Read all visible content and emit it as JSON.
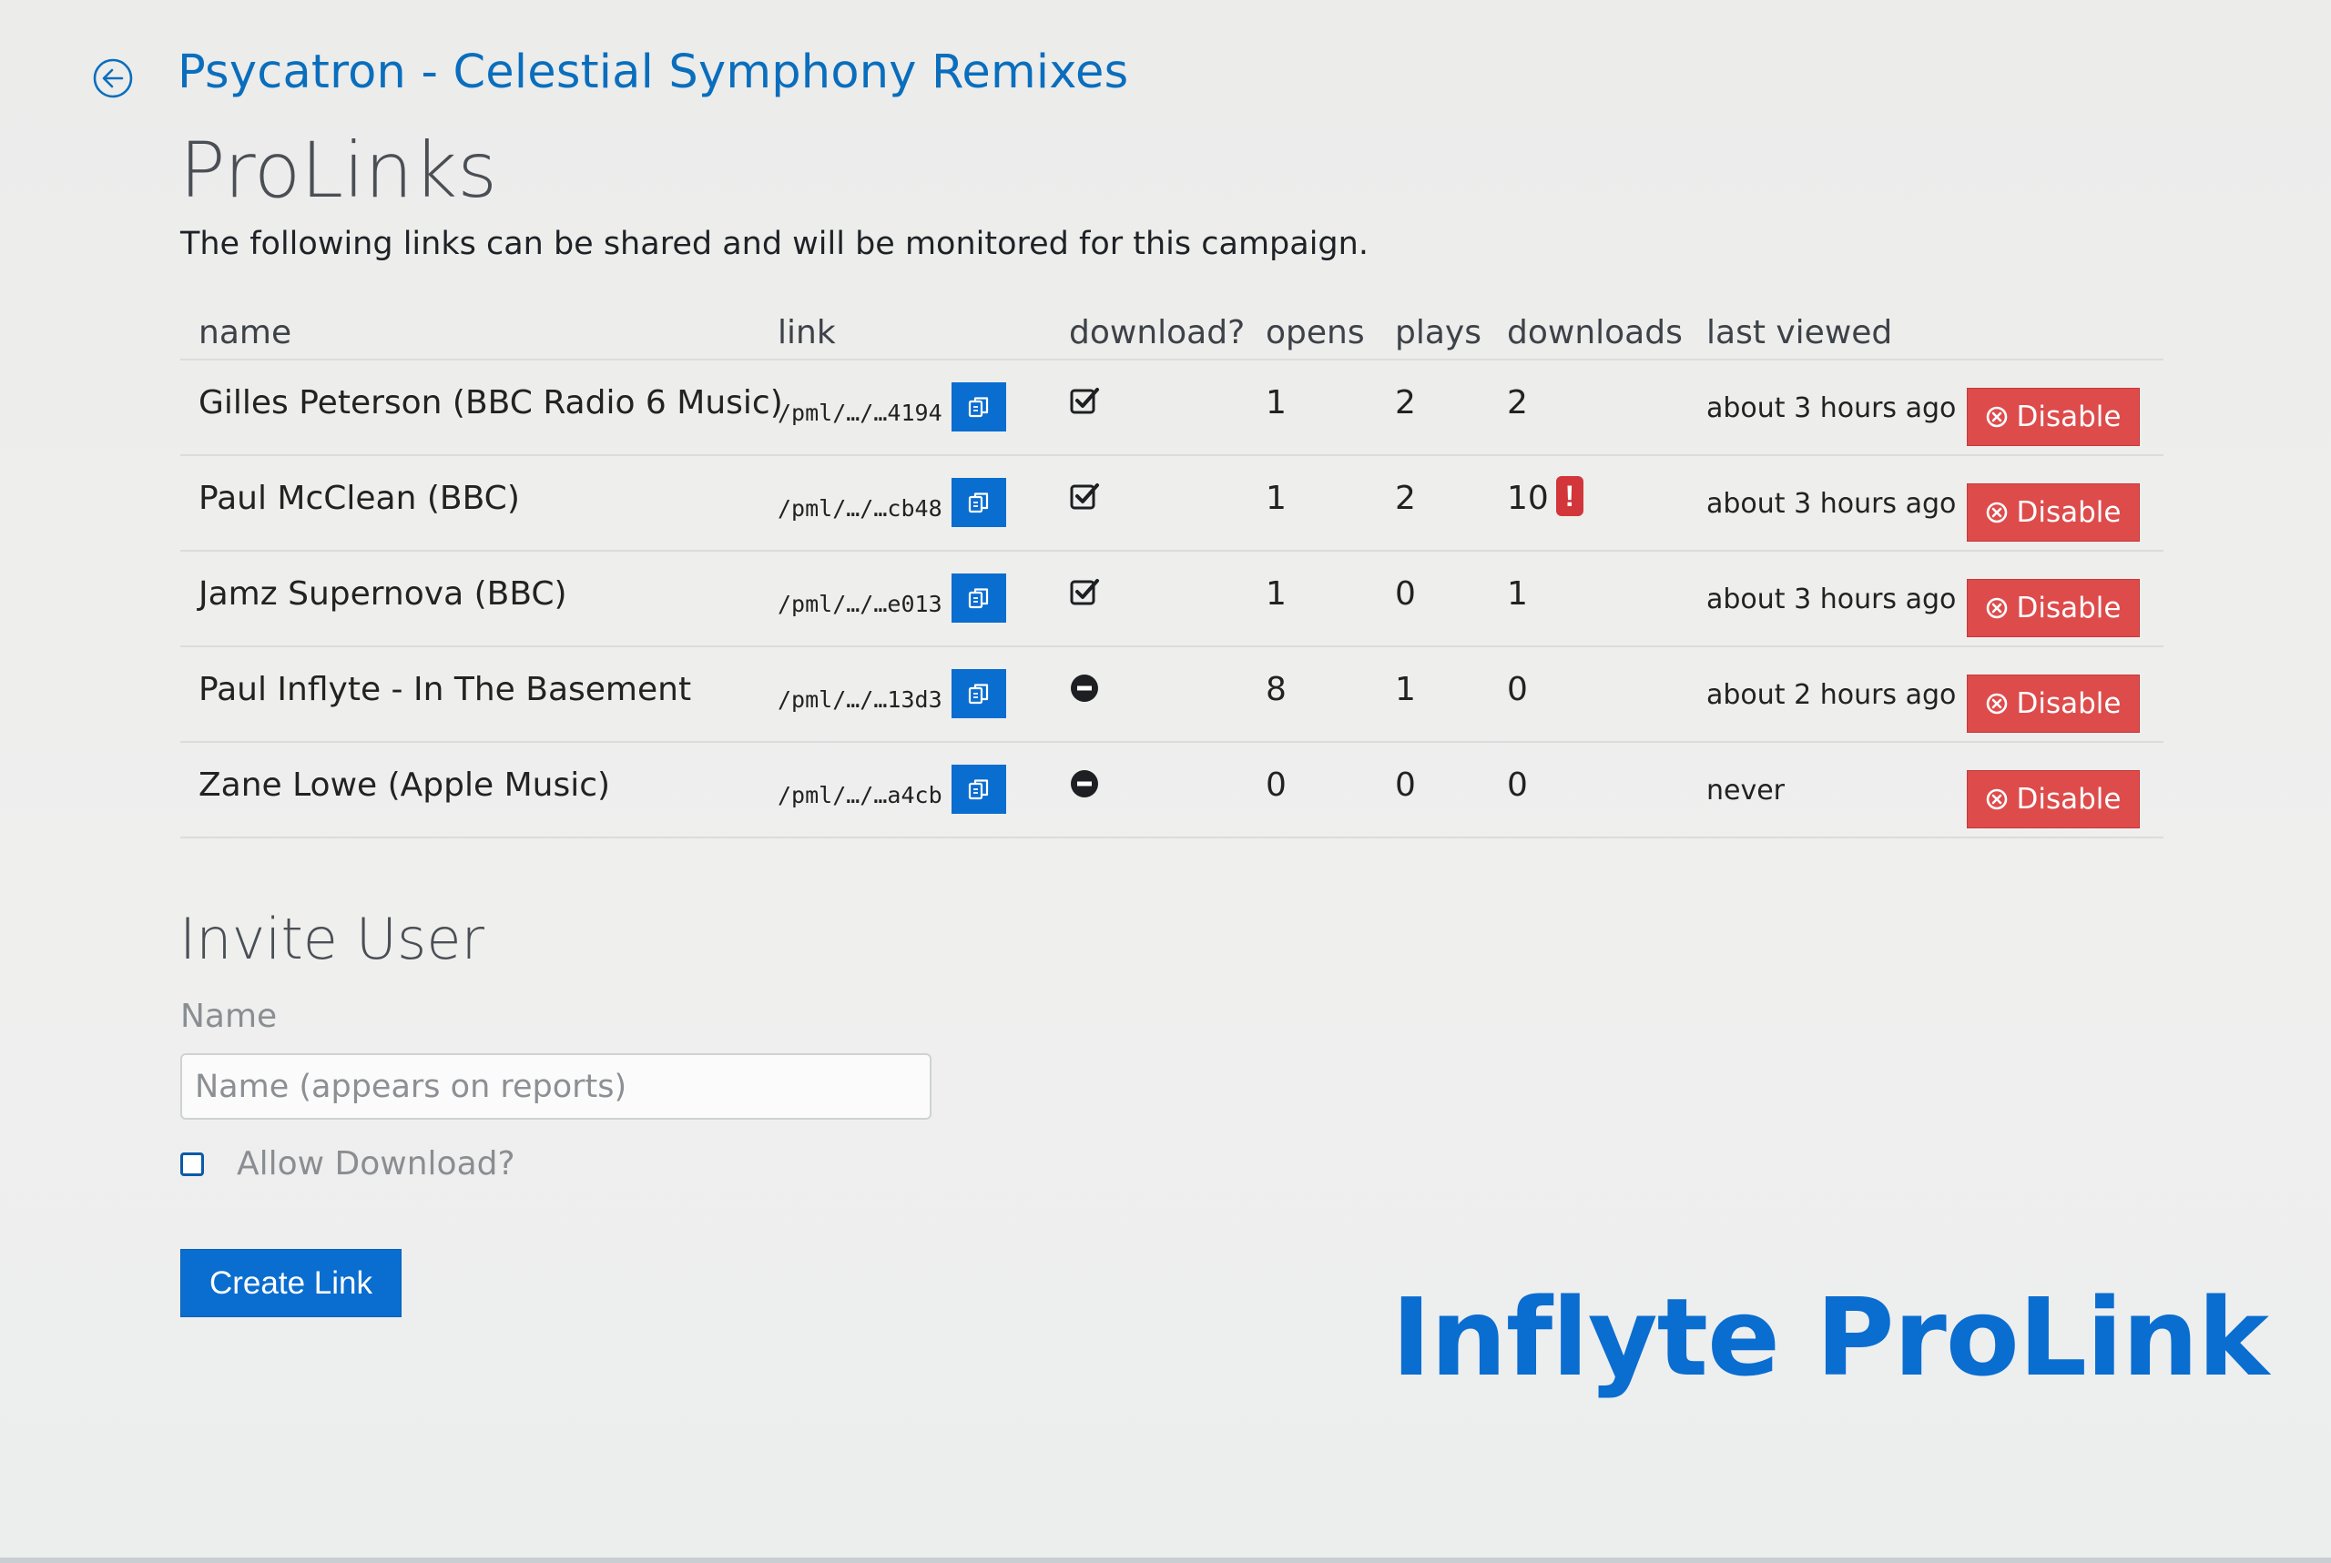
{
  "header": {
    "back_icon": "back-arrow-circle-icon",
    "campaign_title": "Psycatron - Celestial Symphony Remixes",
    "page_title": "ProLinks",
    "description": "The following links can be shared and will be monitored for this campaign."
  },
  "table": {
    "columns": [
      "name",
      "link",
      "download?",
      "opens",
      "plays",
      "downloads",
      "last viewed",
      ""
    ],
    "rows": [
      {
        "name": "Gilles Peterson (BBC Radio 6 Music)",
        "link": "/pml/…/…4194",
        "download": "allowed",
        "opens": "1",
        "plays": "2",
        "downloads": "2",
        "alert": "",
        "last_viewed": "about 3 hours ago",
        "action": "Disable"
      },
      {
        "name": "Paul McClean (BBC)",
        "link": "/pml/…/…cb48",
        "download": "allowed",
        "opens": "1",
        "plays": "2",
        "downloads": "10",
        "alert": "!",
        "last_viewed": "about 3 hours ago",
        "action": "Disable"
      },
      {
        "name": "Jamz Supernova (BBC)",
        "link": "/pml/…/…e013",
        "download": "allowed",
        "opens": "1",
        "plays": "0",
        "downloads": "1",
        "alert": "",
        "last_viewed": "about 3 hours ago",
        "action": "Disable"
      },
      {
        "name": "Paul Inflyte - In The Basement",
        "link": "/pml/…/…13d3",
        "download": "blocked",
        "opens": "8",
        "plays": "1",
        "downloads": "0",
        "alert": "",
        "last_viewed": "about 2 hours ago",
        "action": "Disable"
      },
      {
        "name": "Zane Lowe (Apple Music)",
        "link": "/pml/…/…a4cb",
        "download": "blocked",
        "opens": "0",
        "plays": "0",
        "downloads": "0",
        "alert": "",
        "last_viewed": "never",
        "action": "Disable"
      }
    ]
  },
  "invite": {
    "title": "Invite User",
    "name_label": "Name",
    "name_placeholder": "Name (appears on reports)",
    "name_value": "",
    "allow_download_label": "Allow Download?",
    "allow_download_checked": false,
    "create_button": "Create Link"
  },
  "brand": {
    "text": "Inflyte ProLink"
  },
  "colors": {
    "accent": "#0a6dd0",
    "danger": "#de4b4b",
    "alert": "#d2363a",
    "title_link": "#0a6ebd"
  }
}
